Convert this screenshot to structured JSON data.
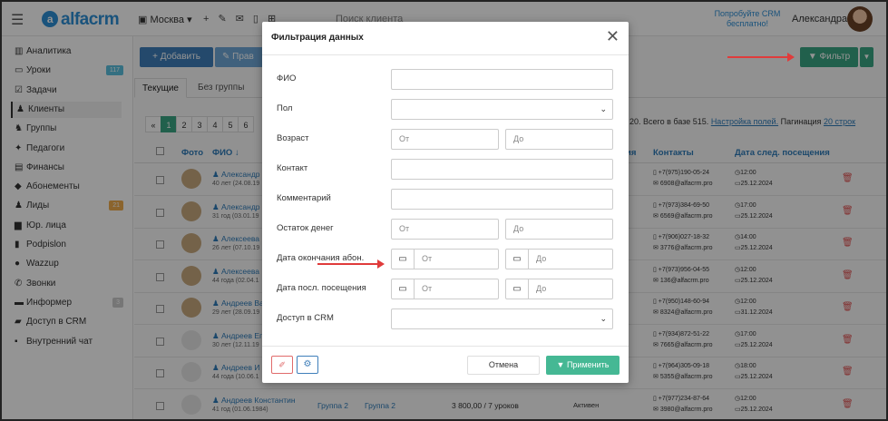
{
  "topbar": {
    "logo": "alfacrm",
    "branch": "Москва",
    "search_placeholder": "Поиск клиента",
    "promo": "Попробуйте CRM бесплатно!",
    "user_name": "Александра"
  },
  "sidebar": {
    "items": [
      {
        "label": "Аналитика",
        "icon": "chart-icon"
      },
      {
        "label": "Уроки",
        "icon": "calendar-icon",
        "badge": "117",
        "badge_color": "#5bc0de"
      },
      {
        "label": "Задачи",
        "icon": "tasks-icon"
      },
      {
        "label": "Клиенты",
        "icon": "user-icon",
        "active": true
      },
      {
        "label": "Группы",
        "icon": "group-icon"
      },
      {
        "label": "Педагоги",
        "icon": "teacher-icon"
      },
      {
        "label": "Финансы",
        "icon": "money-icon"
      },
      {
        "label": "Абонементы",
        "icon": "tag-icon"
      },
      {
        "label": "Лиды",
        "icon": "leads-icon",
        "badge": "21",
        "badge_color": "#f0ad4e"
      },
      {
        "label": "Юр. лица",
        "icon": "briefcase-icon"
      },
      {
        "label": "Podpislon",
        "icon": "doc-icon"
      },
      {
        "label": "Wazzup",
        "icon": "chat-icon"
      },
      {
        "label": "Звонки",
        "icon": "phone-icon"
      },
      {
        "label": "Информер",
        "icon": "informer-icon",
        "badge": "3",
        "badge_color": "#cccccc"
      },
      {
        "label": "Доступ в CRM",
        "icon": "lock-icon"
      },
      {
        "label": "Внутренний чат",
        "icon": "message-icon"
      }
    ]
  },
  "toolbar": {
    "add_label": "+ Добавить",
    "edit_label": "Прав",
    "filter_label": "▼ Фильтр"
  },
  "tabs": [
    "Текущие",
    "Без группы"
  ],
  "pager": {
    "pages": [
      "«",
      "1",
      "2",
      "3",
      "4",
      "5",
      "6"
    ],
    "active": "1"
  },
  "summary": {
    "text": "20. Всего в базе 515.",
    "settings_link": "Настройка полей.",
    "pagination_label": "Пагинация",
    "pagination_value": "20 строк"
  },
  "table": {
    "headers": {
      "photo": "Фото",
      "name": "ФИО ↓",
      "contacts": "Контакты",
      "next_visit": "Дата след. посещения",
      "partial": "ия"
    },
    "rows": [
      {
        "name": "Александр",
        "dob": "40 лет (24.08.19",
        "phone": "+7(975)190-05-24",
        "email": "6908@alfacrm.pro",
        "time": "12:00",
        "date": "25.12.2024",
        "photo": true
      },
      {
        "name": "Александр",
        "dob": "31 год (03.01.19",
        "phone": "+7(973)384-69-50",
        "email": "6569@alfacrm.pro",
        "time": "17:00",
        "date": "25.12.2024",
        "photo": true
      },
      {
        "name": "Алексеева",
        "dob": "26 лет (07.10.19",
        "phone": "+7(906)027-18-32",
        "email": "3776@alfacrm.pro",
        "time": "14:00",
        "date": "25.12.2024",
        "photo": true
      },
      {
        "name": "Алексеева",
        "dob": "44 года (02.04.1",
        "phone": "+7(973)956-04-55",
        "email": "136@alfacrm.pro",
        "time": "12:00",
        "date": "25.12.2024",
        "photo": true
      },
      {
        "name": "Андреев Ва",
        "dob": "29 лет (28.09.19",
        "phone": "+7(950)148-60-94",
        "email": "8324@alfacrm.pro",
        "time": "12:00",
        "date": "31.12.2024",
        "photo": true
      },
      {
        "name": "Андреев Ег",
        "dob": "30 лет (12.11.19",
        "phone": "+7(934)872-51-22",
        "email": "7665@alfacrm.pro",
        "time": "17:00",
        "date": "25.12.2024",
        "photo": false
      },
      {
        "name": "Андреев И",
        "dob": "44 года (10.06.1",
        "phone": "+7(964)305-09-18",
        "email": "5355@alfacrm.pro",
        "time": "18:00",
        "date": "25.12.2024",
        "photo": false
      },
      {
        "name": "Андреев Константин",
        "dob": "41 год (01.06.1984)",
        "group1": "Группа 2",
        "group2": "Группа 2",
        "balance": "3 800,00 / 7 уроков",
        "status": "Активен",
        "phone": "+7(977)234-87-64",
        "email": "3980@alfacrm.pro",
        "time": "12:00",
        "date": "25.12.2024",
        "photo": false
      }
    ]
  },
  "modal": {
    "title": "Фильтрация данных",
    "fields": {
      "fio": "ФИО",
      "gender": "Пол",
      "age": "Возраст",
      "contact": "Контакт",
      "comment": "Комментарий",
      "balance": "Остаток денег",
      "sub_end": "Дата окончания абон.",
      "last_visit": "Дата посл. посещения",
      "crm_access": "Доступ в CRM"
    },
    "from_placeholder": "От",
    "to_placeholder": "До",
    "cancel_label": "Отмена",
    "apply_label": "▼ Применить"
  },
  "colors": {
    "primary": "#3f7fba",
    "success": "#3aa683",
    "danger": "#e05252",
    "annotation_arrow": "#e03b3b"
  }
}
